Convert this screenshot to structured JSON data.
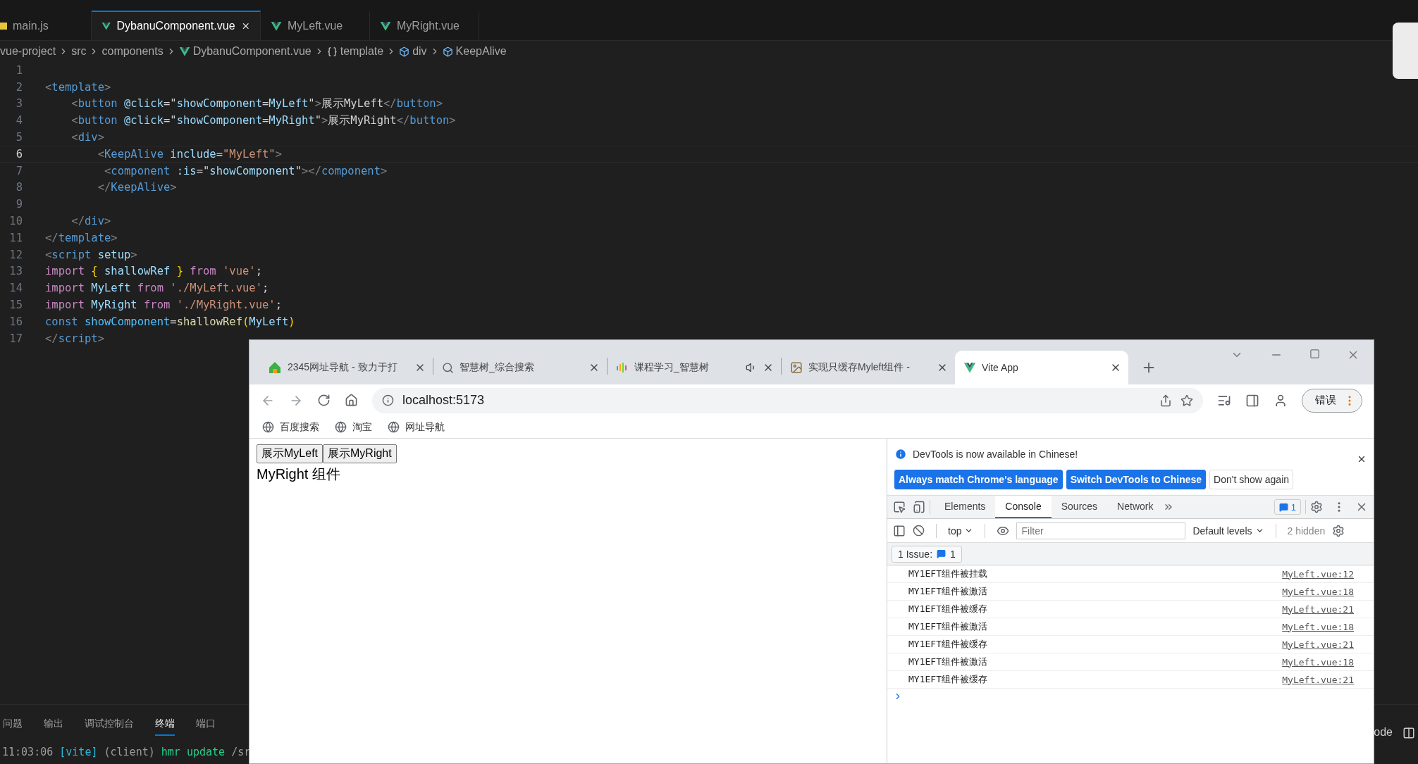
{
  "editor": {
    "tabs": [
      {
        "kind": "js",
        "label": "main.js",
        "selected": false
      },
      {
        "kind": "vue",
        "label": "DybanuComponent.vue",
        "selected": true
      },
      {
        "kind": "vue",
        "label": "MyLeft.vue",
        "selected": false
      },
      {
        "kind": "vue",
        "label": "MyRight.vue",
        "selected": false
      }
    ],
    "breadcrumb": [
      {
        "kind": "plain",
        "label": "vue-project"
      },
      {
        "kind": "plain",
        "label": "src"
      },
      {
        "kind": "plain",
        "label": "components"
      },
      {
        "kind": "vue",
        "label": "DybanuComponent.vue"
      },
      {
        "kind": "braces",
        "label": "template"
      },
      {
        "kind": "cube",
        "label": "div"
      },
      {
        "kind": "cube",
        "label": "KeepAlive"
      }
    ],
    "lines": [
      {
        "number": "1",
        "current": false
      },
      {
        "number": "2",
        "current": false,
        "tokens": [
          {
            "t": "<",
            "kind": "p"
          },
          {
            "t": "template",
            "kind": "tag"
          },
          {
            "t": ">",
            "kind": "p"
          }
        ]
      },
      {
        "number": "3",
        "current": false,
        "tokens": [
          {
            "t": "    <",
            "kind": "p"
          },
          {
            "t": "button",
            "kind": "tag"
          },
          {
            "t": " @click",
            "kind": "attr"
          },
          {
            "t": "=\"",
            "kind": "text"
          },
          {
            "t": "showComponent",
            "kind": "var"
          },
          {
            "t": "=",
            "kind": "text"
          },
          {
            "t": "MyLeft",
            "kind": "var"
          },
          {
            "t": "\"",
            "kind": "text"
          },
          {
            "t": ">",
            "kind": "p"
          },
          {
            "t": "展示MyLeft",
            "kind": "text"
          },
          {
            "t": "</",
            "kind": "p"
          },
          {
            "t": "button",
            "kind": "tag"
          },
          {
            "t": ">",
            "kind": "p"
          }
        ]
      },
      {
        "number": "4",
        "current": false,
        "tokens": [
          {
            "t": "    <",
            "kind": "p"
          },
          {
            "t": "button",
            "kind": "tag"
          },
          {
            "t": " @click",
            "kind": "attr"
          },
          {
            "t": "=\"",
            "kind": "text"
          },
          {
            "t": "showComponent",
            "kind": "var"
          },
          {
            "t": "=",
            "kind": "text"
          },
          {
            "t": "MyRight",
            "kind": "var"
          },
          {
            "t": "\"",
            "kind": "text"
          },
          {
            "t": ">",
            "kind": "p"
          },
          {
            "t": "展示MyRight",
            "kind": "text"
          },
          {
            "t": "</",
            "kind": "p"
          },
          {
            "t": "button",
            "kind": "tag"
          },
          {
            "t": ">",
            "kind": "p"
          }
        ]
      },
      {
        "number": "5",
        "current": false,
        "tokens": [
          {
            "t": "    <",
            "kind": "p"
          },
          {
            "t": "div",
            "kind": "tag"
          },
          {
            "t": ">",
            "kind": "p"
          }
        ]
      },
      {
        "number": "6",
        "current": true,
        "tokens": [
          {
            "t": "        <",
            "kind": "p"
          },
          {
            "t": "KeepAlive",
            "kind": "tag"
          },
          {
            "t": " include",
            "kind": "attr"
          },
          {
            "t": "=",
            "kind": "text"
          },
          {
            "t": "\"MyLeft\"",
            "kind": "str"
          },
          {
            "t": ">",
            "kind": "p"
          }
        ]
      },
      {
        "number": "7",
        "current": false,
        "tokens": [
          {
            "t": "         <",
            "kind": "p"
          },
          {
            "t": "component",
            "kind": "tag"
          },
          {
            "t": " :is",
            "kind": "attr"
          },
          {
            "t": "=\"",
            "kind": "text"
          },
          {
            "t": "showComponent",
            "kind": "var"
          },
          {
            "t": "\"",
            "kind": "text"
          },
          {
            "t": "></",
            "kind": "p"
          },
          {
            "t": "component",
            "kind": "tag"
          },
          {
            "t": ">",
            "kind": "p"
          }
        ]
      },
      {
        "number": "8",
        "current": false,
        "tokens": [
          {
            "t": "        </",
            "kind": "p"
          },
          {
            "t": "KeepAlive",
            "kind": "tag"
          },
          {
            "t": ">",
            "kind": "p"
          }
        ]
      },
      {
        "number": "9",
        "current": false
      },
      {
        "number": "10",
        "current": false,
        "tokens": [
          {
            "t": "    </",
            "kind": "p"
          },
          {
            "t": "div",
            "kind": "tag"
          },
          {
            "t": ">",
            "kind": "p"
          }
        ]
      },
      {
        "number": "11",
        "current": false,
        "tokens": [
          {
            "t": "</",
            "kind": "p"
          },
          {
            "t": "template",
            "kind": "tag"
          },
          {
            "t": ">",
            "kind": "p"
          }
        ]
      },
      {
        "number": "12",
        "current": false,
        "tokens": [
          {
            "t": "<",
            "kind": "p"
          },
          {
            "t": "script",
            "kind": "tag"
          },
          {
            "t": " setup",
            "kind": "attr"
          },
          {
            "t": ">",
            "kind": "p"
          }
        ]
      },
      {
        "number": "13",
        "current": false,
        "tokens": [
          {
            "t": "import ",
            "kind": "kw"
          },
          {
            "t": "{",
            "kind": "brace"
          },
          {
            "t": " shallowRef ",
            "kind": "var"
          },
          {
            "t": "}",
            "kind": "brace"
          },
          {
            "t": " from ",
            "kind": "kw"
          },
          {
            "t": "'vue'",
            "kind": "str"
          },
          {
            "t": ";",
            "kind": "text"
          }
        ]
      },
      {
        "number": "14",
        "current": false,
        "tokens": [
          {
            "t": "import",
            "kind": "kw"
          },
          {
            "t": " MyLeft ",
            "kind": "var"
          },
          {
            "t": "from ",
            "kind": "kw"
          },
          {
            "t": "'./MyLeft.vue'",
            "kind": "str"
          },
          {
            "t": ";",
            "kind": "text"
          }
        ]
      },
      {
        "number": "15",
        "current": false,
        "tokens": [
          {
            "t": "import",
            "kind": "kw"
          },
          {
            "t": " MyRight ",
            "kind": "var"
          },
          {
            "t": "from ",
            "kind": "kw"
          },
          {
            "t": "'./MyRight.vue'",
            "kind": "str"
          },
          {
            "t": ";",
            "kind": "text"
          }
        ]
      },
      {
        "number": "16",
        "current": false,
        "tokens": [
          {
            "t": "const ",
            "kind": "tag"
          },
          {
            "t": "showComponent",
            "kind": "const"
          },
          {
            "t": "=",
            "kind": "text"
          },
          {
            "t": "shallowRef",
            "kind": "fn"
          },
          {
            "t": "(",
            "kind": "brace"
          },
          {
            "t": "MyLeft",
            "kind": "var"
          },
          {
            "t": ")",
            "kind": "brace"
          }
        ]
      },
      {
        "number": "17",
        "current": false,
        "tokens": [
          {
            "t": "</",
            "kind": "p"
          },
          {
            "t": "script",
            "kind": "tag"
          },
          {
            "t": ">",
            "kind": "p"
          }
        ]
      }
    ]
  },
  "panel": {
    "tabs": [
      {
        "label": "问题",
        "selected": false
      },
      {
        "label": "输出",
        "selected": false
      },
      {
        "label": "调试控制台",
        "selected": false
      },
      {
        "label": "终端",
        "selected": true
      },
      {
        "label": "端口",
        "selected": false
      }
    ],
    "terminal_line": [
      {
        "t": "11:03:06 ",
        "kind": "dim"
      },
      {
        "t": "[vite]",
        "kind": "cyan"
      },
      {
        "t": " (client) ",
        "kind": "dim"
      },
      {
        "t": "hmr update ",
        "kind": "green"
      },
      {
        "t": "/sr",
        "kind": "dim"
      }
    ],
    "right_label": "ode"
  },
  "browser": {
    "tabs": [
      {
        "kind": "house",
        "title": "2345网址导航 - 致力于打",
        "selected": false,
        "audio": false
      },
      {
        "kind": "search",
        "title": "智慧树_综合搜索",
        "selected": false,
        "audio": false
      },
      {
        "kind": "bars",
        "title": "课程学习_智慧树",
        "selected": false,
        "audio": true
      },
      {
        "kind": "image",
        "title": "实现只缓存Myleft组件 -",
        "selected": false,
        "audio": false
      },
      {
        "kind": "vue",
        "title": "Vite App",
        "selected": true,
        "audio": false
      }
    ],
    "address": "localhost:5173",
    "profile_button": "错误",
    "bookmarks": [
      "百度搜索",
      "淘宝",
      "网址导航"
    ],
    "page": {
      "buttons": [
        "展示MyLeft",
        "展示MyRight"
      ],
      "text": "MyRight 组件"
    },
    "devtools": {
      "notice": "DevTools is now available in Chinese!",
      "notice_buttons": [
        {
          "label": "Always match Chrome's language",
          "kind": "primary"
        },
        {
          "label": "Switch DevTools to Chinese",
          "kind": "primary"
        },
        {
          "label": "Don't show again",
          "kind": "plain"
        }
      ],
      "tabs": [
        {
          "label": "Elements",
          "selected": false
        },
        {
          "label": "Console",
          "selected": true
        },
        {
          "label": "Sources",
          "selected": false
        },
        {
          "label": "Network",
          "selected": false
        }
      ],
      "issue_count": "1",
      "context": "top",
      "filter_placeholder": "Filter",
      "levels": "Default levels",
      "hidden": "2 hidden",
      "issues_label": "1 Issue:",
      "issues_badge": "1",
      "messages": [
        {
          "text": "MY1EFT组件被挂载",
          "source": "MyLeft.vue:12"
        },
        {
          "text": "MY1EFT组件被激活",
          "source": "MyLeft.vue:18"
        },
        {
          "text": "MY1EFT组件被缓存",
          "source": "MyLeft.vue:21"
        },
        {
          "text": "MY1EFT组件被激活",
          "source": "MyLeft.vue:18"
        },
        {
          "text": "MY1EFT组件被缓存",
          "source": "MyLeft.vue:21"
        },
        {
          "text": "MY1EFT组件被激活",
          "source": "MyLeft.vue:18"
        },
        {
          "text": "MY1EFT组件被缓存",
          "source": "MyLeft.vue:21"
        }
      ]
    }
  }
}
